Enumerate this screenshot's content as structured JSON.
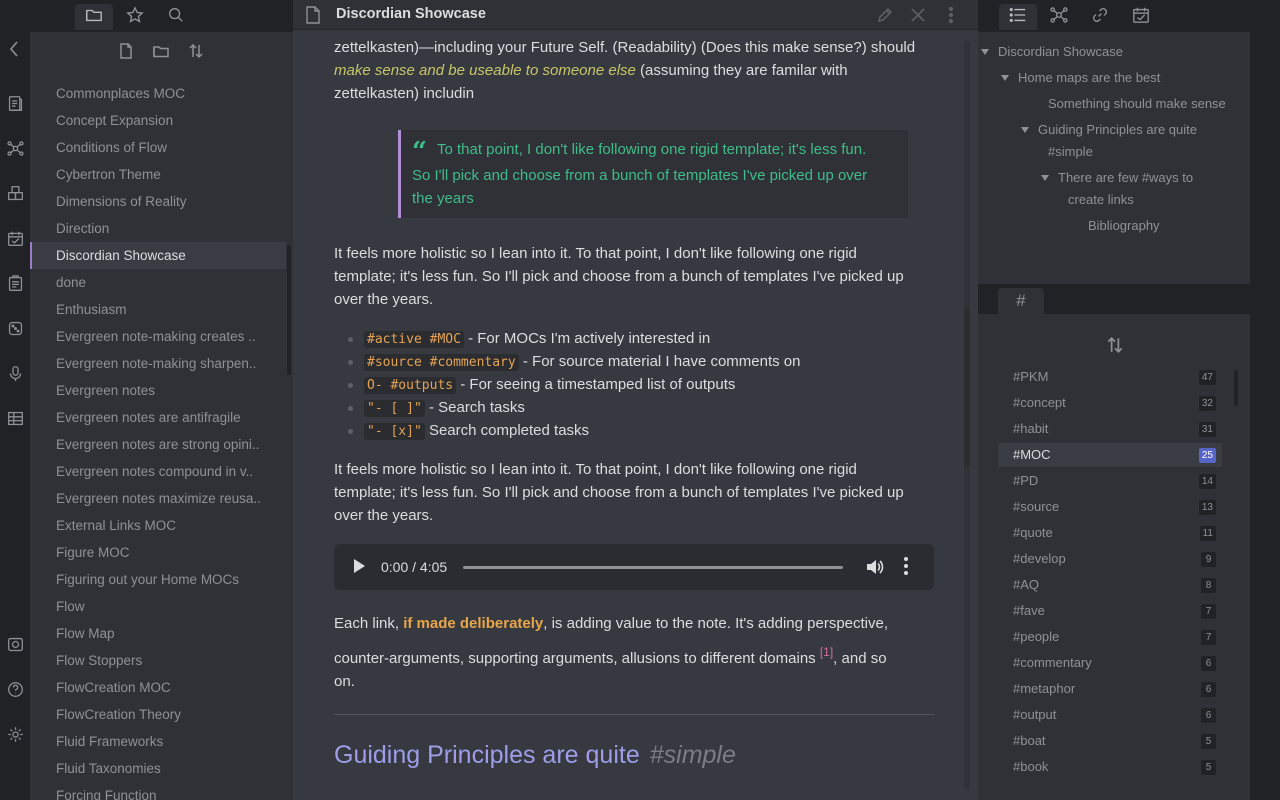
{
  "editor": {
    "title": "Discordian Showcase",
    "para1_line1": "zettelkasten)—including your Future Self. (Readability) (Does this make sense?) should",
    "para1_em": "make sense and be useable to someone else",
    "para1_rest": " (assuming they are familar with",
    "para1_line3": "zettelkasten) includin",
    "quote_mark": "“",
    "quote_line1": "To that point, I don't like following one rigid template; it's less fun.",
    "quote_line2": "So I'll pick and choose from a bunch of templates I've picked up over",
    "quote_line3": "the years",
    "para2_line1": "It feels more holistic so I lean into it. To that point, I don't like following one rigid",
    "para2_line2": "template; it's less fun. So I'll pick and choose from a bunch of templates I've picked up",
    "para2_line3": "over the years.",
    "list": [
      {
        "code": "#active #MOC",
        "text": " - For MOCs I'm actively interested in"
      },
      {
        "code": "#source #commentary",
        "text": " - For source material I have comments on"
      },
      {
        "code": "O- #outputs",
        "text": " - For seeing a timestamped list of outputs"
      },
      {
        "code": "\"- [ ]\"",
        "text": " - Search tasks"
      },
      {
        "code": "\"- [x]\"",
        "text": " Search completed tasks"
      }
    ],
    "para3_line1": "It feels more holistic so I lean into it. To that point, I don't like following one rigid",
    "para3_line2": "template; it's less fun. So I'll pick and choose from a bunch of templates I've picked up",
    "para3_line3": "over the years.",
    "audio_time": "0:00 / 4:05",
    "para4_start": "Each link, ",
    "para4_bold": "if made deliberately",
    "para4_rest": ", is adding value to the note. It's adding perspective,",
    "para4_line2": "counter-arguments, supporting arguments, allusions to different domains ",
    "para4_fn": "[1]",
    "para4_end": ", and so",
    "para4_line3": "on.",
    "heading": "Guiding Principles are quite",
    "heading_tag": "#simple"
  },
  "files": [
    "Commonplaces MOC",
    "Concept Expansion",
    "Conditions of Flow",
    "Cybertron Theme",
    "Dimensions of Reality",
    "Direction",
    "Discordian Showcase",
    "done",
    "Enthusiasm",
    "Evergreen note-making creates ..",
    "Evergreen note-making sharpen..",
    "Evergreen notes",
    "Evergreen notes are antifragile",
    "Evergreen notes are strong opini..",
    "Evergreen notes compound in v..",
    "Evergreen notes maximize reusa..",
    "External Links MOC",
    "Figure MOC",
    "Figuring out your Home MOCs",
    "Flow",
    "Flow Map",
    "Flow Stoppers",
    "FlowCreation MOC",
    "FlowCreation Theory",
    "Fluid Frameworks",
    "Fluid Taxonomies",
    "Forcing Function"
  ],
  "active_file_index": 6,
  "outline": [
    {
      "label": "Discordian Showcase",
      "caret": true
    },
    {
      "label": "Home maps are the best",
      "caret": true
    },
    {
      "label": "Something should make sense",
      "caret": false
    },
    {
      "label": "Guiding Principles are quite",
      "caret": true
    },
    {
      "label": "#simple",
      "caret": false
    },
    {
      "label": "There are few #ways to",
      "caret": true
    },
    {
      "label": "create links",
      "caret": false
    },
    {
      "label": "Bibliography",
      "caret": false
    }
  ],
  "tag_tab_label": "#",
  "tags": [
    {
      "name": "#PKM",
      "count": "47"
    },
    {
      "name": "#concept",
      "count": "32"
    },
    {
      "name": "#habit",
      "count": "31"
    },
    {
      "name": "#MOC",
      "count": "25"
    },
    {
      "name": "#PD",
      "count": "14"
    },
    {
      "name": "#source",
      "count": "13"
    },
    {
      "name": "#quote",
      "count": "11"
    },
    {
      "name": "#develop",
      "count": "9"
    },
    {
      "name": "#AQ",
      "count": "8"
    },
    {
      "name": "#fave",
      "count": "7"
    },
    {
      "name": "#people",
      "count": "7"
    },
    {
      "name": "#commentary",
      "count": "6"
    },
    {
      "name": "#metaphor",
      "count": "6"
    },
    {
      "name": "#output",
      "count": "6"
    },
    {
      "name": "#boat",
      "count": "5"
    },
    {
      "name": "#book",
      "count": "5"
    }
  ],
  "active_tag_index": 3,
  "colors": {
    "accent_purple": "#9b7ec8",
    "quote_green": "#3fbc8a",
    "code_orange": "#e6a354",
    "heading": "#9f9ce8",
    "count_badge_active": "#5865c8"
  },
  "icons": {
    "left_tabs": [
      "folder-icon",
      "star-icon",
      "search-icon"
    ],
    "file_actions": [
      "new-note-icon",
      "new-folder-icon",
      "sort-icon"
    ],
    "right_tabs": [
      "outline-icon",
      "graph-icon",
      "link-icon",
      "calendar-icon"
    ],
    "editor_actions": [
      "edit-icon",
      "close-icon",
      "more-icon"
    ]
  }
}
